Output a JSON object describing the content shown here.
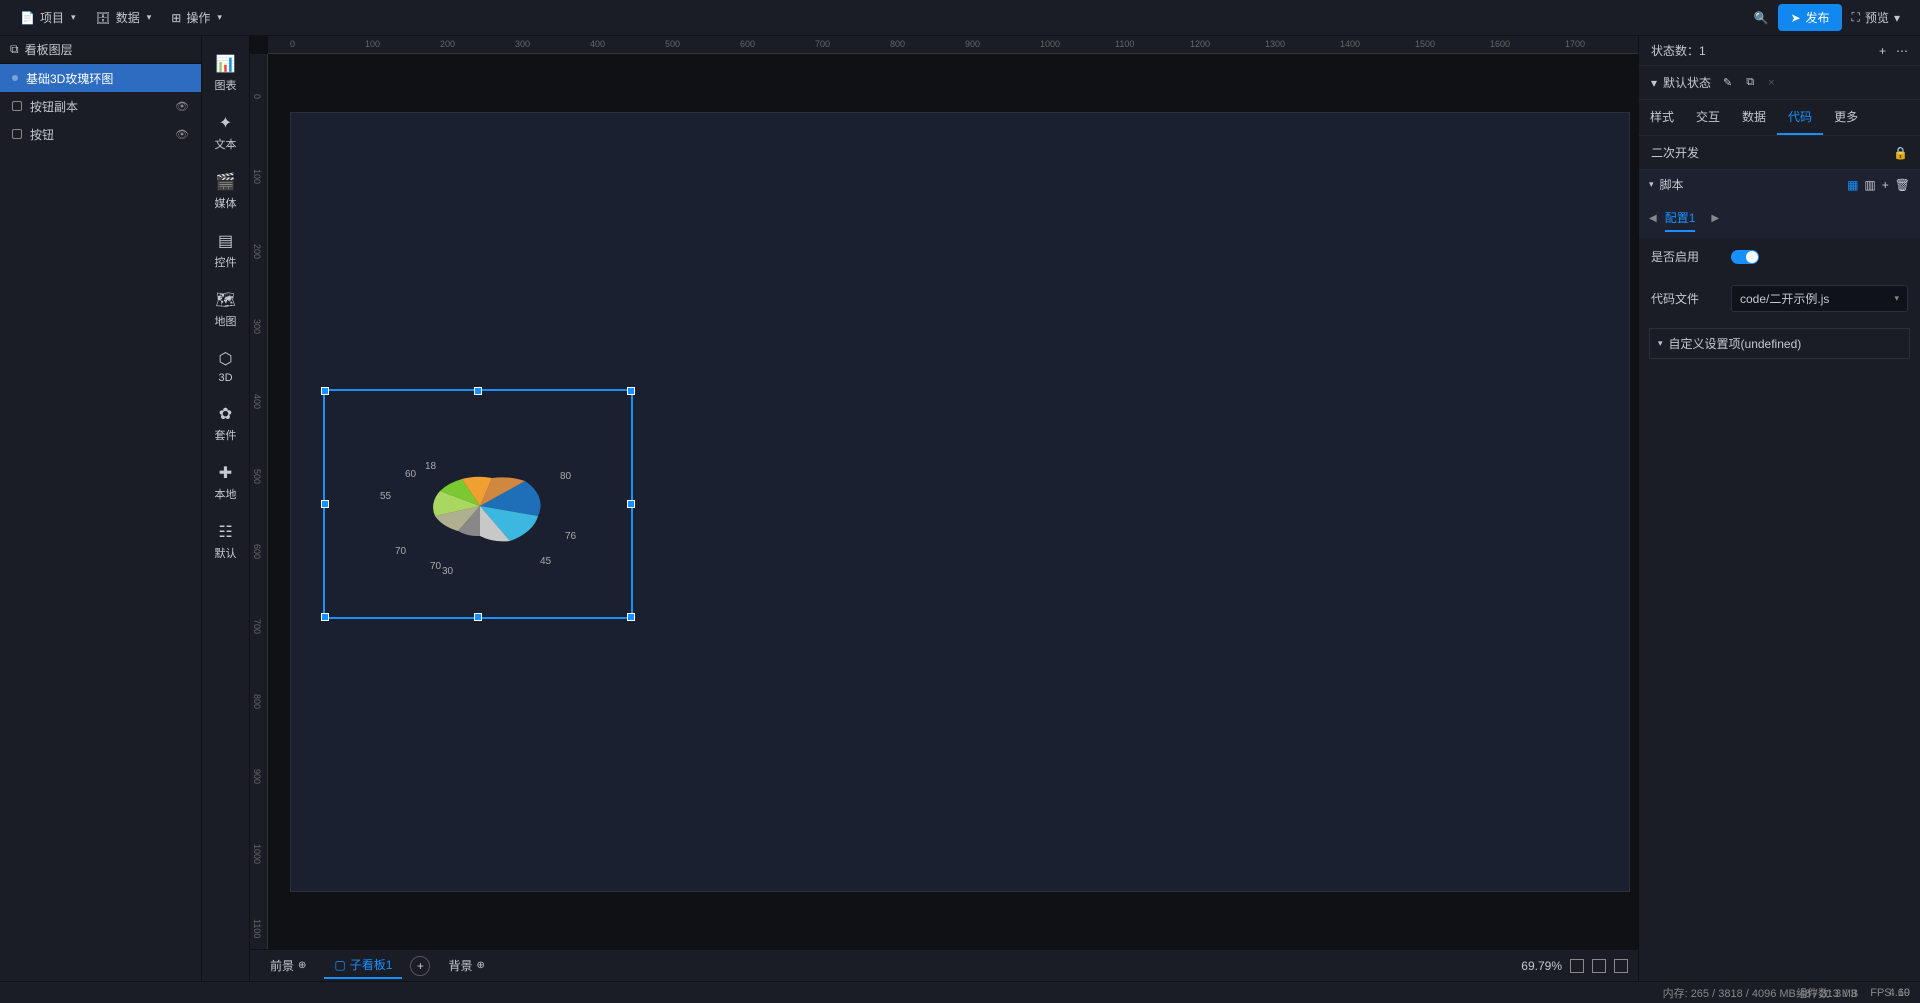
{
  "topbar": {
    "project": "项目",
    "data": "数据",
    "operations": "操作",
    "publish": "发布",
    "preview": "预览"
  },
  "layers": {
    "title": "看板图层",
    "items": [
      {
        "name": "基础3D玫瑰环图",
        "active": true,
        "icon": "dot"
      },
      {
        "name": "按钮副本",
        "icon": "sq",
        "eye": true
      },
      {
        "name": "按钮",
        "icon": "sq",
        "eye": true
      }
    ]
  },
  "tools": [
    {
      "label": "图表",
      "icon": "📊"
    },
    {
      "label": "文本",
      "icon": "✦"
    },
    {
      "label": "媒体",
      "icon": "🎬"
    },
    {
      "label": "控件",
      "icon": "▤"
    },
    {
      "label": "地图",
      "icon": "🗺"
    },
    {
      "label": "3D",
      "icon": "⬡"
    },
    {
      "label": "套件",
      "icon": "✿"
    },
    {
      "label": "本地",
      "icon": "✚"
    },
    {
      "label": "默认",
      "icon": "☷"
    }
  ],
  "ruler_h": [
    "0",
    "100",
    "200",
    "300",
    "400",
    "500",
    "600",
    "700",
    "800",
    "900",
    "1000",
    "1100",
    "1200",
    "1300",
    "1400",
    "1500",
    "1600",
    "1700"
  ],
  "ruler_v": [
    "0",
    "100",
    "200",
    "300",
    "400",
    "500",
    "600",
    "700",
    "800",
    "900",
    "1000",
    "1100"
  ],
  "chart_data": {
    "type": "pie",
    "title": "基础3D玫瑰环图",
    "values": [
      80,
      76,
      45,
      30,
      70,
      70,
      55,
      60,
      18
    ],
    "colors": [
      "#1e6fb8",
      "#3cb8e0",
      "#c8c8c8",
      "#888888",
      "#b0b090",
      "#a8d860",
      "#7cc830",
      "#f0a030",
      "#d08840"
    ]
  },
  "right_panel": {
    "state_count_label": "状态数：",
    "state_count": "1",
    "default_state": "默认状态",
    "tabs": [
      "样式",
      "交互",
      "数据",
      "代码",
      "更多"
    ],
    "active_tab": 3,
    "sub_header": "二次开发",
    "script_section": "脚本",
    "config_tab": "配置1",
    "enable_label": "是否启用",
    "code_file_label": "代码文件",
    "code_file_value": "code/二开示例.js",
    "custom_settings": "自定义设置项(undefined)"
  },
  "bottom": {
    "foreground": "前景",
    "sub_board": "子看板1",
    "background": "背景",
    "zoom": "69.79%"
  },
  "status": {
    "memory": "内存:  265 / 3818 / 4096 MB  48 / 313 MB",
    "fps": "FPS:  60",
    "components": "组件数: 3 / 3",
    "version": "4.19"
  }
}
